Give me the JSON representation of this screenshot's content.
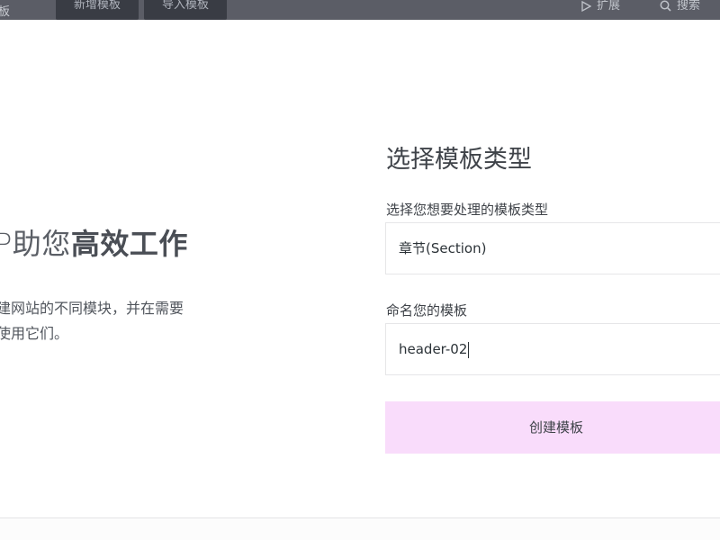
{
  "topbar": {
    "left_fragment": "板",
    "tabs": [
      {
        "label": "新增模板"
      },
      {
        "label": "导入模板"
      }
    ],
    "extensions_label": "扩展",
    "search_label": "搜索"
  },
  "hero": {
    "title_prefix": "P助您",
    "title_bold": "高效工作",
    "desc_line1": "建网站的不同模块，并在需要",
    "desc_line2": "使用它们。"
  },
  "form": {
    "title": "选择模板类型",
    "type_label": "选择您想要处理的模板类型",
    "type_value": "章节(Section)",
    "name_label": "命名您的模板",
    "name_value": "header-02",
    "submit_label": "创建模板"
  }
}
